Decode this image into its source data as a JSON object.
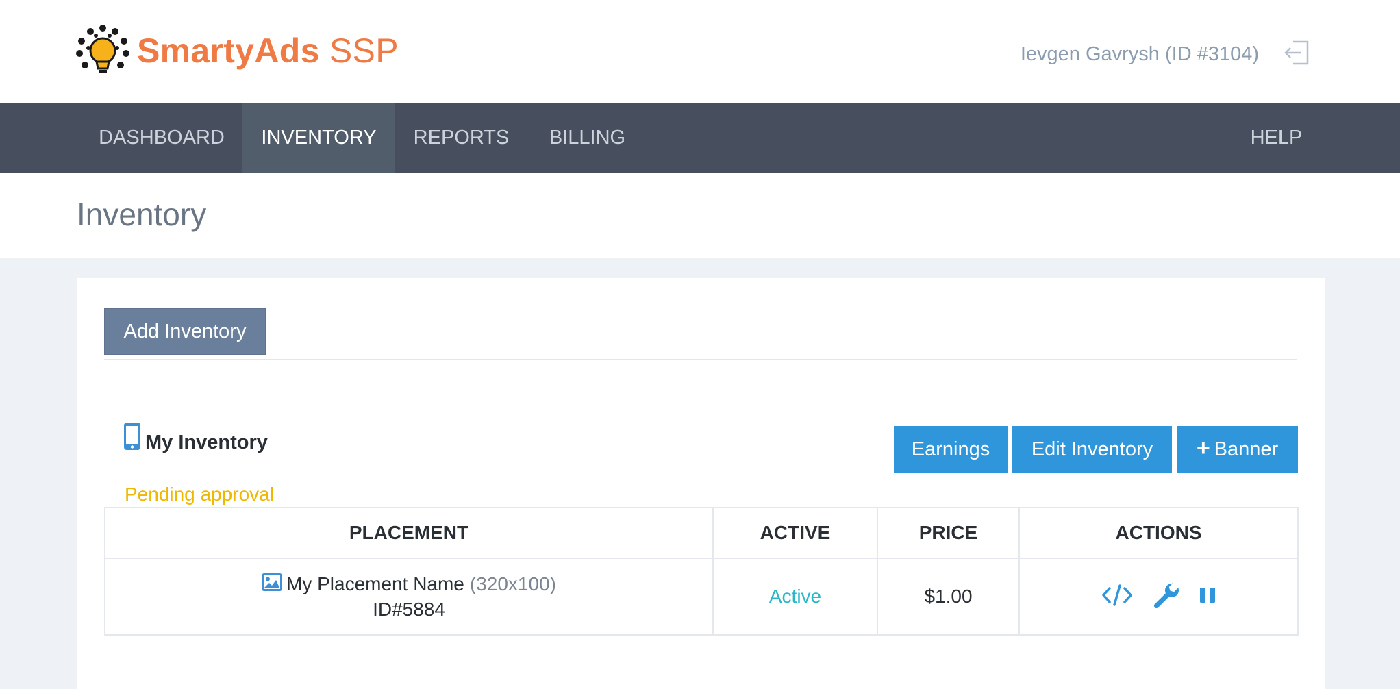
{
  "brand": {
    "name_bold": "SmartyAds",
    "name_light": " SSP"
  },
  "user": {
    "label": "Ievgen Gavrysh (ID #3104)"
  },
  "nav": {
    "items": [
      {
        "label": "DASHBOARD"
      },
      {
        "label": "INVENTORY"
      },
      {
        "label": "REPORTS"
      },
      {
        "label": "BILLING"
      }
    ],
    "help": "HELP",
    "active": "INVENTORY"
  },
  "page": {
    "title": "Inventory"
  },
  "toolbar": {
    "add_label": "Add Inventory"
  },
  "inventory": {
    "title": "My Inventory",
    "status": "Pending approval",
    "buttons": {
      "earnings": "Earnings",
      "edit": "Edit Inventory",
      "banner_plus": "+",
      "banner": "Banner"
    }
  },
  "table": {
    "headers": [
      "PLACEMENT",
      "ACTIVE",
      "PRICE",
      "ACTIONS"
    ],
    "rows": [
      {
        "name": "My Placement Name",
        "size": "(320x100)",
        "id": "ID#5884",
        "active": "Active",
        "price": "$1.00",
        "actions": [
          "code-icon",
          "wrench-icon",
          "pause-icon"
        ]
      }
    ]
  },
  "colors": {
    "brand": "#ef7a44",
    "nav_bg": "#474e5d",
    "primary_button": "#2f96dc",
    "secondary_button": "#6a7f9c",
    "pending": "#efb800",
    "active_status": "#29b8c9"
  }
}
